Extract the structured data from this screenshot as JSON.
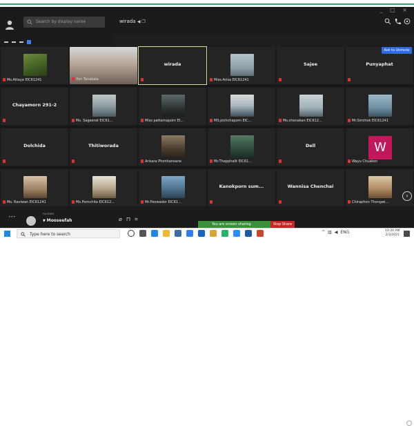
{
  "sidebar": {
    "search_placeholder": "Search by display name"
  },
  "chat": {
    "title": "wirada",
    "admit_label": "Ask to Unmute",
    "last_message_name": "Mooseefah",
    "last_message_preview": "no.state"
  },
  "participants": [
    {
      "name": "Ms.Attaya EIC61241",
      "type": "photo",
      "cls": "p1"
    },
    {
      "name": "ภัทร Tanakaia",
      "type": "big",
      "cls": ""
    },
    {
      "name": "wirada",
      "type": "name",
      "active": true
    },
    {
      "name": "Miss.Arisa EIC61241",
      "type": "photo",
      "cls": "p2"
    },
    {
      "name": "Sajee",
      "type": "name"
    },
    {
      "name": "Punyaphat",
      "type": "name"
    },
    {
      "name": "Chayamorn 291-2",
      "type": "name"
    },
    {
      "name": "Ms. Sageerat EIC61...",
      "type": "photo",
      "cls": "p3"
    },
    {
      "name": "Miss pattamaporn EI...",
      "type": "photo",
      "cls": "p4"
    },
    {
      "name": "MS.pichchaporn EIC...",
      "type": "photo",
      "cls": "p5"
    },
    {
      "name": "Ms.chanakan EIC612...",
      "type": "photo",
      "cls": "p6"
    },
    {
      "name": "Mr.Sirichok EIC61241",
      "type": "photo",
      "cls": "p7"
    },
    {
      "name": "Dolchida",
      "type": "name"
    },
    {
      "name": "Thitiworada",
      "type": "name"
    },
    {
      "name": "Arisara Phonhansane",
      "type": "photo",
      "cls": "p8"
    },
    {
      "name": "Mr.Thepphalit EIC61...",
      "type": "photo",
      "cls": "p10"
    },
    {
      "name": "Dell",
      "type": "name"
    },
    {
      "name": "Wayu Chuakon",
      "type": "w"
    },
    {
      "name": "Ms. Raviwan EIC61241",
      "type": "photo",
      "cls": "p9"
    },
    {
      "name": "Ms.Pornchita EIC612...",
      "type": "photo",
      "cls": "p11"
    },
    {
      "name": "Mr.Poowador EIC61...",
      "type": "photo",
      "cls": "p12"
    },
    {
      "name": "Kanokporn sum...",
      "type": "name"
    },
    {
      "name": "Wannisa Chenchai",
      "type": "name"
    },
    {
      "name": "Chiraphon Thongwi...",
      "type": "photo",
      "cls": "p13"
    }
  ],
  "share": {
    "status": "You are screen sharing",
    "stop_label": "Stop Share"
  },
  "taskbar": {
    "search_placeholder": "Type here to search",
    "lang": "ENG",
    "time": "10:30 AM",
    "date": "2/3/2021"
  },
  "colors": {
    "accent_green": "#3aa36b",
    "share_green": "#3b8f3b",
    "stop_red": "#c62828",
    "admit_blue": "#2d6cdf",
    "w_tile": "#c2185b"
  }
}
